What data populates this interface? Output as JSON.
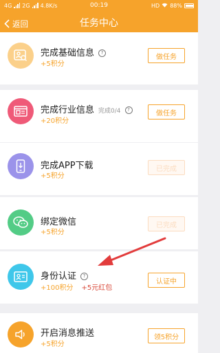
{
  "status_bar": {
    "network": "4G",
    "network2": "2G",
    "speed": "4.8K/s",
    "time": "00:19",
    "hd": "HD",
    "battery": "88%"
  },
  "header": {
    "back_label": "返回",
    "title": "任务中心"
  },
  "tasks": [
    {
      "title": "完成基础信息",
      "progress": "",
      "reward": "+5积分",
      "bonus": "",
      "button": "做任务",
      "button_done": false,
      "icon": "profile-card-icon",
      "color": "#fbd08a"
    },
    {
      "title": "完成行业信息",
      "progress": "完成0/4",
      "reward": "+20积分",
      "bonus": "",
      "button": "做任务",
      "button_done": false,
      "icon": "browser-window-icon",
      "color": "#ef5a78"
    },
    {
      "title": "完成APP下载",
      "progress": "",
      "reward": "+5积分",
      "bonus": "",
      "button": "已完成",
      "button_done": true,
      "icon": "phone-download-icon",
      "color": "#9b93ea"
    },
    {
      "title": "绑定微信",
      "progress": "",
      "reward": "+5积分",
      "bonus": "",
      "button": "已完成",
      "button_done": true,
      "icon": "wechat-icon",
      "color": "#53cc86"
    },
    {
      "title": "身份认证",
      "progress": "",
      "reward": "+100积分",
      "bonus": "+5元红包",
      "button": "认证中",
      "button_done": false,
      "icon": "id-card-icon",
      "color": "#3fc7ea"
    },
    {
      "title": "开启消息推送",
      "progress": "",
      "reward": "+5积分",
      "bonus": "",
      "button": "领5积分",
      "button_done": false,
      "icon": "speaker-icon",
      "color": "#f6a32b"
    }
  ],
  "colors": {
    "accent": "#f6a32b",
    "bonus_red": "#d94b3c",
    "annotation_arrow": "#e23c3c"
  }
}
